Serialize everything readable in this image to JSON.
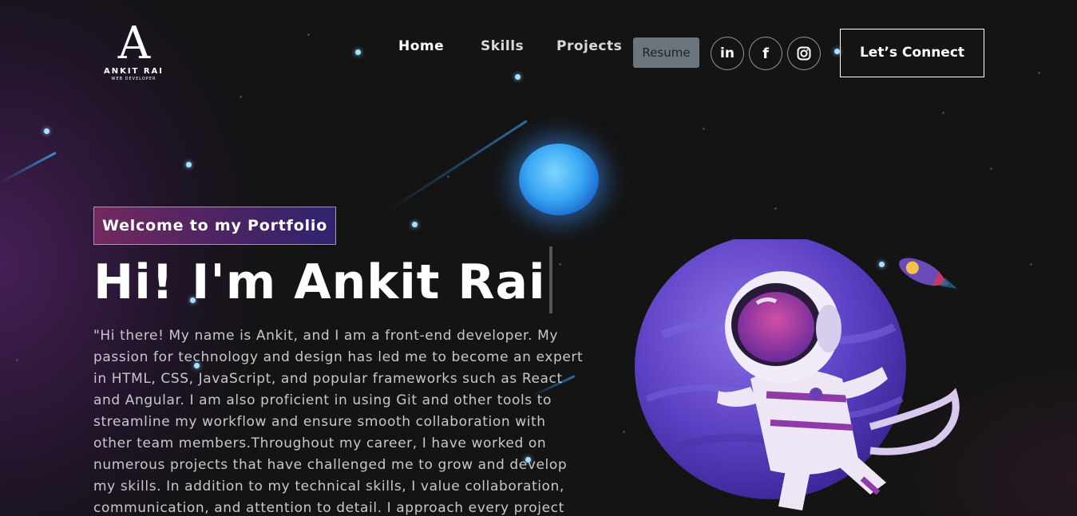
{
  "brand": {
    "logo_letter": "A",
    "name": "ANKIT RAI",
    "subtitle": "WEB DEVELOPER"
  },
  "nav": {
    "links": [
      "Home",
      "Skills",
      "Projects"
    ],
    "resume_label": "Resume",
    "socials": [
      {
        "icon": "linkedin-icon",
        "glyph": "in"
      },
      {
        "icon": "facebook-icon",
        "glyph": "f"
      },
      {
        "icon": "instagram-icon",
        "glyph": ""
      }
    ],
    "connect_label": "Let’s Connect"
  },
  "hero": {
    "tagline": "Welcome to my Portfolio",
    "headline": "Hi! I'm Ankit Rai",
    "bio": "\"Hi there! My name is Ankit, and I am a front-end developer. My passion for technology and design has led me to become an expert in HTML, CSS, JavaScript, and popular frameworks such as React and Angular. I am also proficient in using Git and other tools to streamline my workflow and ensure smooth collaboration with other team members.Throughout my career, I have worked on numerous projects that have challenged me to grow and develop my skills. In addition to my technical skills, I value collaboration, communication, and attention to detail. I approach every project"
  },
  "colors": {
    "background": "#121212",
    "tagline_gradient_start": "#aa367c",
    "tagline_gradient_end": "#4a2fbd",
    "resume_bg": "#6c757d",
    "planet": "#6a4fd0",
    "orb": "#3aa7f2"
  }
}
